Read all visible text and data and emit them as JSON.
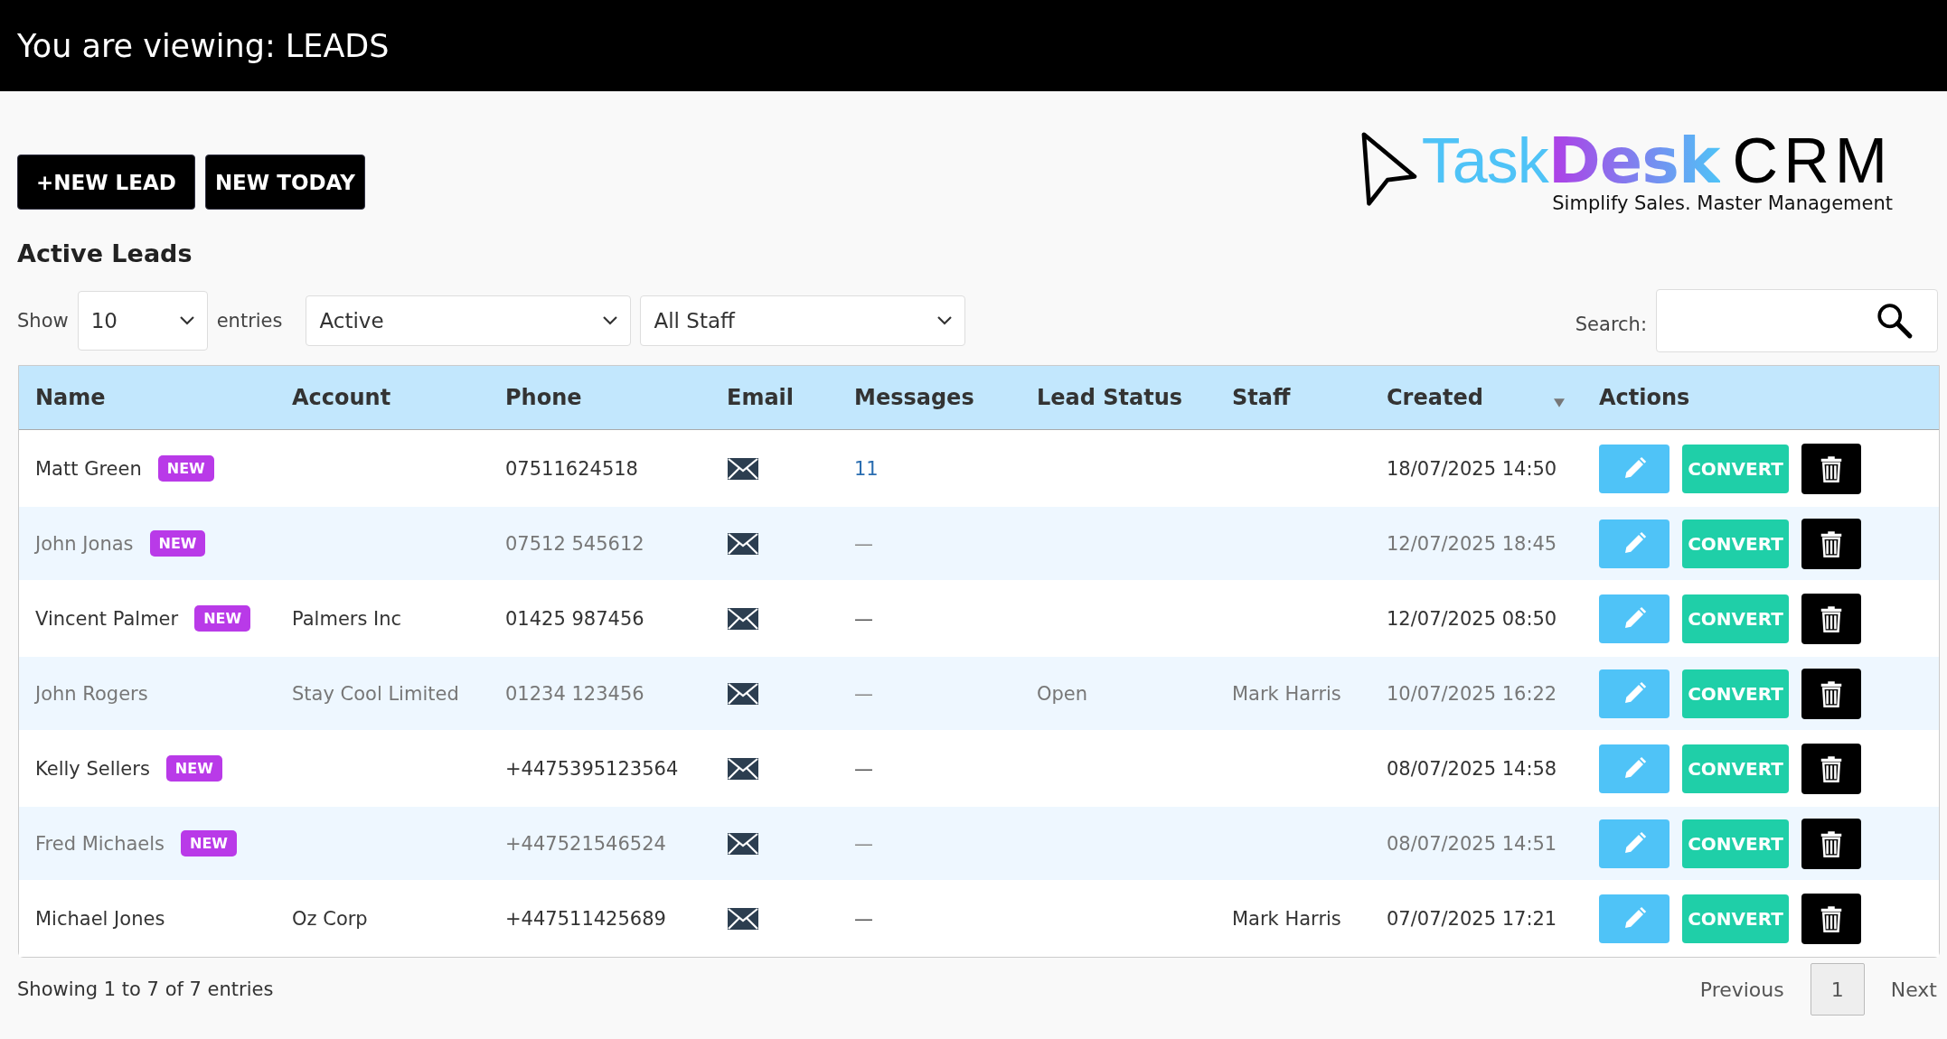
{
  "header": {
    "title": "You are viewing: LEADS"
  },
  "buttons": [
    {
      "label": "+NEW LEAD"
    },
    {
      "label": "NEW TODAY"
    }
  ],
  "logo": {
    "parts": [
      {
        "text": "Task",
        "kind": "light"
      },
      {
        "text": "Desk",
        "kind": "gradient"
      },
      {
        "text": "CRM",
        "kind": "plain"
      }
    ],
    "tagline": "Simplify Sales. Master Management"
  },
  "section_title": "Active Leads",
  "filters": {
    "show_label": "Show",
    "page_size": "10",
    "entries_label": "entries",
    "status": "Active",
    "staff": "All Staff",
    "search_label": "Search:"
  },
  "table": {
    "columns": [
      {
        "label": "Name",
        "sorted": false
      },
      {
        "label": "Account",
        "sorted": false
      },
      {
        "label": "Phone",
        "sorted": false
      },
      {
        "label": "Email",
        "sorted": false
      },
      {
        "label": "Messages",
        "sorted": false
      },
      {
        "label": "Lead Status",
        "sorted": false
      },
      {
        "label": "Staff",
        "sorted": false
      },
      {
        "label": "Created",
        "sorted": true
      },
      {
        "label": "Actions",
        "sorted": false
      }
    ],
    "rows": [
      {
        "name": "Matt Green",
        "badge": "NEW",
        "account": "",
        "phone": "07511624518",
        "messages": "11",
        "lead_status": "",
        "staff": "",
        "created": "18/07/2025 14:50",
        "action": "CONVERT"
      },
      {
        "name": "John Jonas",
        "badge": "NEW",
        "account": "",
        "phone": "07512 545612",
        "messages": "—",
        "lead_status": "",
        "staff": "",
        "created": "12/07/2025 18:45",
        "action": "CONVERT"
      },
      {
        "name": "Vincent Palmer",
        "badge": "NEW",
        "account": "Palmers Inc",
        "phone": "01425 987456",
        "messages": "—",
        "lead_status": "",
        "staff": "",
        "created": "12/07/2025 08:50",
        "action": "CONVERT"
      },
      {
        "name": "John Rogers",
        "account": "Stay Cool Limited",
        "phone": "01234 123456",
        "messages": "—",
        "lead_status": "Open",
        "staff": "Mark Harris",
        "created": "10/07/2025 16:22",
        "action": "CONVERT"
      },
      {
        "name": "Kelly Sellers",
        "badge": "NEW",
        "account": "",
        "phone": "+4475395123564",
        "messages": "—",
        "lead_status": "",
        "staff": "",
        "created": "08/07/2025 14:58",
        "action": "CONVERT"
      },
      {
        "name": "Fred Michaels",
        "badge": "NEW",
        "account": "",
        "phone": "+447521546524",
        "messages": "—",
        "lead_status": "",
        "staff": "",
        "created": "08/07/2025 14:51",
        "action": "CONVERT"
      },
      {
        "name": "Michael Jones",
        "account": "Oz Corp",
        "phone": "+447511425689",
        "messages": "—",
        "lead_status": "",
        "staff": "Mark Harris",
        "created": "07/07/2025 17:21",
        "action": "CONVERT"
      }
    ]
  },
  "footer": {
    "info": "Showing 1 to 7 of 7 entries",
    "pagination": [
      {
        "label": "Previous",
        "kind": "nav",
        "selected": false
      },
      {
        "label": "1",
        "kind": "page",
        "selected": true
      },
      {
        "label": "Next",
        "kind": "nav",
        "selected": false
      }
    ]
  }
}
